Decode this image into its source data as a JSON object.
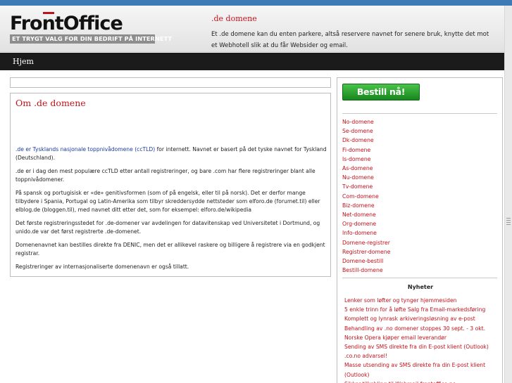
{
  "header": {
    "logo_text_pre": "Fro",
    "logo_text_o": "n",
    "logo_text_post": "tOffice",
    "logo_tagline": "ET TRYGT VALG FOR DIN BEDRIFT PÅ INTERNETT",
    "title": ".de domene",
    "description": "Et .de domene kan du enten parkere, altså reservere navnet for senere bruk, knytte det mot et Webhotell slik at du får Websider og email."
  },
  "nav": {
    "items": [
      {
        "label": "Hjem"
      }
    ]
  },
  "article": {
    "title": "Om .de domene",
    "paragraphs": [
      {
        "link": ".de er Tysklands nasjonale toppnivådomene (ccTLD)",
        "text": " for internett. Navnet er basert på det tyske navnet for Tyskland (Deutschland)."
      },
      {
        "link": "",
        "text": ".de er i dag den mest populære ccTLD etter antall registreringer, og bare .com har flere registreringer blant alle toppnivådomener."
      },
      {
        "link": "",
        "text": "På spansk og portugisisk er «de» genitivsformen (som of på engelsk, eller til på norsk). Det er derfor mange tilbydere i Spania, Portugal og Latin-Amerika som tilbyr skreddersydde nettsteder som elforo.de (forumet.til) eller elblog.de (bloggen.til), med navnet ditt etter det, som for eksempel: elforo.de/wikipedia"
      },
      {
        "link": "",
        "text": "Det første registreringsstedet for .de-domener var avdelingen for datavitenskap ved Universitetet i Dortmund, og unido.de var det først registrerte .de-domenet."
      },
      {
        "link": "",
        "text": "Domenenavnet kan bestilles direkte fra DENIC, men det er allikevel raskere og billigere å registrere via en godkjent registrar."
      },
      {
        "link": "",
        "text": "Registreringer av internasjonaliserte domenenavn er også tillatt."
      }
    ]
  },
  "sidebar": {
    "order_button": "Bestill nå!",
    "domain_links": [
      "No-domene",
      "Se-domene",
      "Dk-domene",
      "Fi-domene",
      "Is-domene",
      "As-domene",
      "Nu-domene",
      "Tv-domene",
      "Com-domene",
      "Biz-domene",
      "Net-domene",
      "Org-domene",
      "Info-domene",
      "Domene-registrer",
      "Registrer-domene",
      "Domene-bestill",
      "Bestill-domene"
    ],
    "news_title": "Nyheter",
    "news_links": [
      "Lenker som løfter og tynger hjemmesiden",
      "5 enkle trinn for å løfte Salg fra Email-markedsføring",
      "Komplett og lynrask arkiveringsløsning av e-post",
      "Behandling av .no domener stoppes 30 sept. - 3 okt.",
      "Norske Opera kjøper email leverandør",
      "Sending av SMS direkte fra din E-post klient (Outlook)",
      ".co.no advarsel!",
      "Masse utsending av SMS direkte fra din E-post klient (Outlook)",
      "Sikker tilkobling til Webmail frontoffice.no"
    ]
  },
  "colors": {
    "accent_red": "#c0121b",
    "nav_bg": "#1b1b1b",
    "top_bar": "#3f79b6",
    "button_green": "#17871d"
  }
}
